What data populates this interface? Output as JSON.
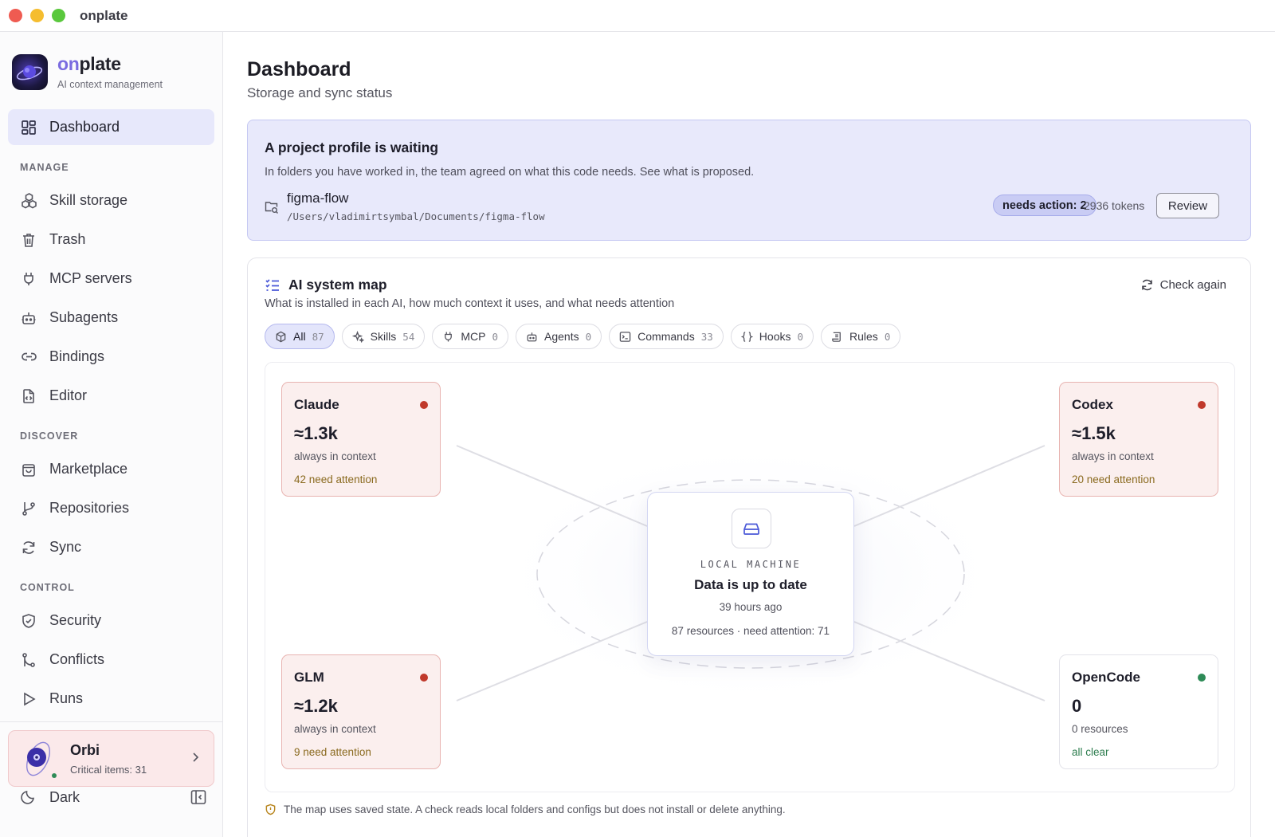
{
  "window": {
    "title": "onplate"
  },
  "brand": {
    "name_prefix": "on",
    "name_suffix": "plate",
    "subtitle": "AI context management"
  },
  "nav": {
    "dashboard": "Dashboard",
    "manage_label": "MANAGE",
    "skill_storage": "Skill storage",
    "trash": "Trash",
    "mcp_servers": "MCP servers",
    "subagents": "Subagents",
    "bindings": "Bindings",
    "editor": "Editor",
    "discover_label": "DISCOVER",
    "marketplace": "Marketplace",
    "repositories": "Repositories",
    "sync": "Sync",
    "control_label": "CONTROL",
    "security": "Security",
    "conflicts": "Conflicts",
    "runs": "Runs"
  },
  "orbi": {
    "name": "Orbi",
    "subtitle": "Critical items: 31"
  },
  "theme": {
    "label": "Dark"
  },
  "page": {
    "title": "Dashboard",
    "subtitle": "Storage and sync status"
  },
  "banner": {
    "title": "A project profile is waiting",
    "description": "In folders you have worked in, the team agreed on what this code needs. See what is proposed.",
    "project_name": "figma-flow",
    "project_path": "/Users/vladimirtsymbal/Documents/figma-flow",
    "badge": "needs action: 2",
    "tokens": "2936 tokens",
    "review_label": "Review"
  },
  "map": {
    "title": "AI system map",
    "description": "What is installed in each AI, how much context it uses, and what needs attention",
    "check_again": "Check again",
    "filters": [
      {
        "label": "All",
        "count": "87"
      },
      {
        "label": "Skills",
        "count": "54"
      },
      {
        "label": "MCP",
        "count": "0"
      },
      {
        "label": "Agents",
        "count": "0"
      },
      {
        "label": "Commands",
        "count": "33"
      },
      {
        "label": "Hooks",
        "count": "0"
      },
      {
        "label": "Rules",
        "count": "0"
      }
    ],
    "nodes": [
      {
        "name": "Claude",
        "value": "≈1.3k",
        "caption": "always in context",
        "status": "42 need attention"
      },
      {
        "name": "Codex",
        "value": "≈1.5k",
        "caption": "always in context",
        "status": "20 need attention"
      },
      {
        "name": "GLM",
        "value": "≈1.2k",
        "caption": "always in context",
        "status": "9 need attention"
      },
      {
        "name": "OpenCode",
        "value": "0",
        "caption": "0 resources",
        "status": "all clear"
      }
    ],
    "center": {
      "label": "LOCAL MACHINE",
      "title": "Data is up to date",
      "time": "39 hours ago",
      "resources": "87 resources · need attention: 71"
    },
    "note": "The map uses saved state. A check reads local folders and configs but does not install or delete anything."
  },
  "colors": {
    "accent": "#4a58d8",
    "warning_dot": "#c0392b",
    "ok_dot": "#2e8b57",
    "warning_text": "#8a6a1f",
    "ok_text": "#2e7d4f"
  }
}
